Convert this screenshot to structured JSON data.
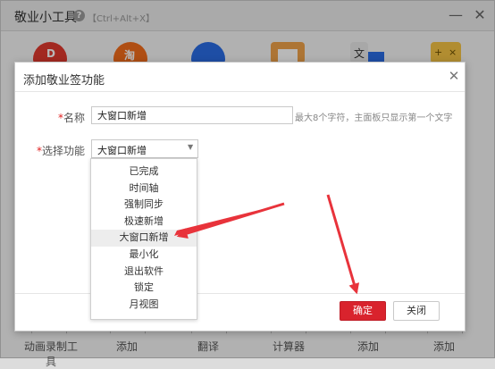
{
  "app": {
    "title": "敬业小工具",
    "shortcut": "【Ctrl+Alt+X】",
    "tiles": [
      "D",
      "淘",
      "",
      "",
      "文",
      ""
    ],
    "bottom_labels": [
      "动画录制工具",
      "添加",
      "翻译",
      "计算器",
      "添加",
      "添加"
    ]
  },
  "dialog": {
    "title": "添加敬业签功能",
    "name_label": "名称",
    "name_value": "大窗口新增",
    "name_hint": "最大8个字符，主面板只显示第一个文字",
    "function_label": "选择功能",
    "function_value": "大窗口新增",
    "ok_label": "确定",
    "close_label": "关闭"
  },
  "dropdown": {
    "options": [
      "已完成",
      "时间轴",
      "强制同步",
      "极速新增",
      "大窗口新增",
      "最小化",
      "退出软件",
      "锁定",
      "月视图"
    ],
    "selected_index": 4
  },
  "colors": {
    "accent": "#d9232d",
    "arrow": "#e8333b"
  }
}
